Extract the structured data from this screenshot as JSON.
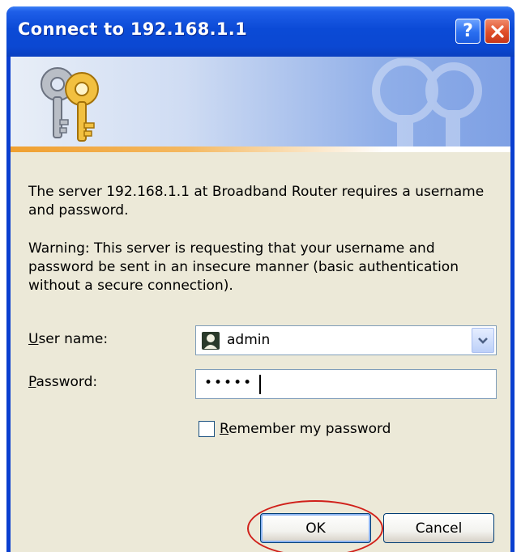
{
  "window": {
    "title": "Connect to 192.168.1.1"
  },
  "titlebar_buttons": {
    "help_label": "?",
    "close_icon": "close-x-icon"
  },
  "banner": {
    "icon": "keys-icon"
  },
  "messages": {
    "server": "The server 192.168.1.1 at Broadband Router requires a username and password.",
    "warning": "Warning: This server is requesting that your username and password be sent in an insecure manner (basic authentication without a secure connection)."
  },
  "form": {
    "user_label_accel": "U",
    "user_label_rest": "ser name:",
    "username": "admin",
    "password_label_accel": "P",
    "password_label_rest": "assword:",
    "password_masked": "•••••",
    "remember_accel": "R",
    "remember_rest": "emember my password",
    "remember_checked": false
  },
  "buttons": {
    "ok": "OK",
    "cancel": "Cancel"
  },
  "colors": {
    "titlebar": "#0b48d2",
    "dialog_bg": "#ece9d8",
    "highlight": "#d0201a"
  }
}
